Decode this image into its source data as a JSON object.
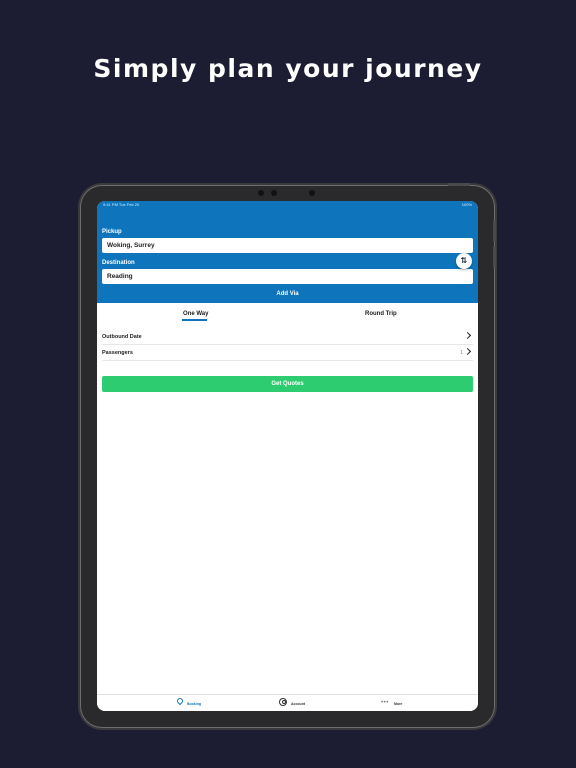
{
  "headline": "Simply plan your journey",
  "status_bar": {
    "left": "9:41 PM   Tue Feb 20",
    "right": "100%"
  },
  "form": {
    "pickup_label": "Pickup",
    "pickup_value": "Woking, Surrey",
    "destination_label": "Destination",
    "destination_value": "Reading",
    "swap_icon": "swap-icon",
    "swap_glyph": "⇅",
    "add_via": "Add Via"
  },
  "trip_tabs": [
    {
      "label": "One Way",
      "active": true
    },
    {
      "label": "Round Trip",
      "active": false
    }
  ],
  "rows": {
    "outbound_label": "Outbound Date",
    "passengers_label": "Passengers",
    "passengers_value": "1"
  },
  "get_quotes": "Get Quotes",
  "tabbar": {
    "booking": "Booking",
    "account": "Account",
    "more": "More",
    "more_glyph": "•••"
  },
  "colors": {
    "background": "#1c1c32",
    "brand_blue": "#0e75bd",
    "cta_green": "#2ecc71"
  }
}
